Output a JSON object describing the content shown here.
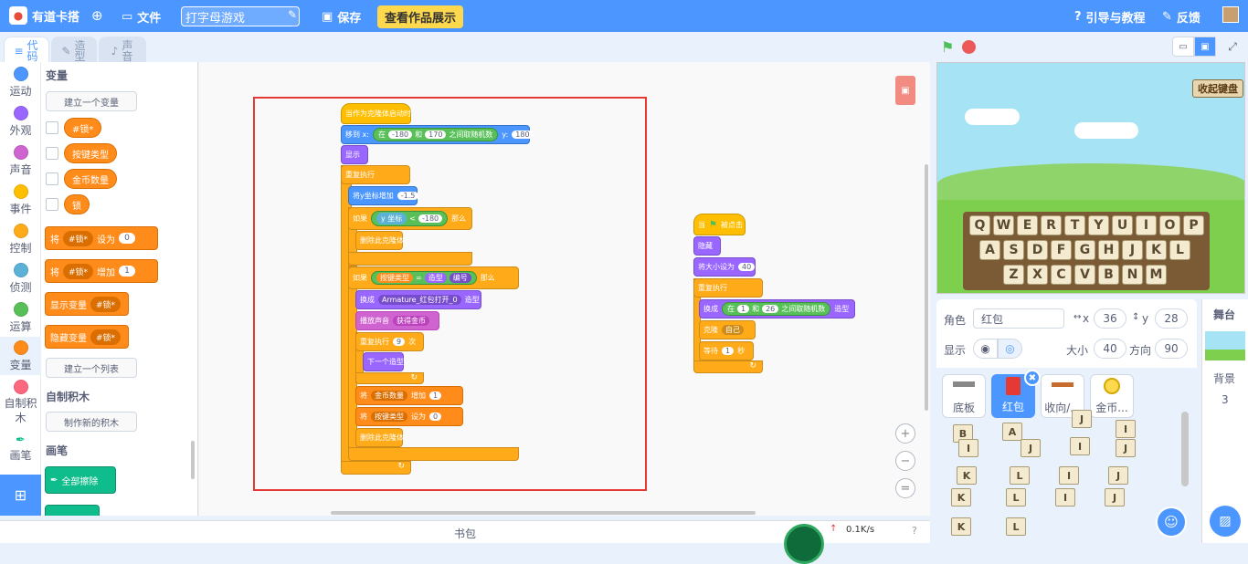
{
  "topbar": {
    "brand": "有道卡搭",
    "file_menu": "文件",
    "project_name": "打字母游戏",
    "save": "保存",
    "showcase": "查看作品展示",
    "guide": "引导与教程",
    "feedback": "反馈"
  },
  "tabs": [
    {
      "label": "代码",
      "active": true
    },
    {
      "label": "造型",
      "active": false
    },
    {
      "label": "声音",
      "active": false
    }
  ],
  "categories": [
    {
      "label": "运动",
      "color": "#4c97ff"
    },
    {
      "label": "外观",
      "color": "#9966ff"
    },
    {
      "label": "声音",
      "color": "#cf63cf"
    },
    {
      "label": "事件",
      "color": "#ffbf00"
    },
    {
      "label": "控制",
      "color": "#ffab19"
    },
    {
      "label": "侦测",
      "color": "#5cb1d6"
    },
    {
      "label": "运算",
      "color": "#59c059"
    },
    {
      "label": "变量",
      "color": "#ff8c1a",
      "selected": true
    },
    {
      "label": "自制积木",
      "color": "#ff6680"
    },
    {
      "label": "画笔",
      "color": "#0fbd8c"
    }
  ],
  "palette": {
    "var_heading": "变量",
    "make_var": "建立一个变量",
    "variables": [
      "#锁*",
      "按键类型",
      "金币数量",
      "锁"
    ],
    "set_block": {
      "prefix": "将",
      "var": "#锁*",
      "mid": "设为",
      "value": "0"
    },
    "change_block": {
      "prefix": "将",
      "var": "#锁*",
      "mid": "增加",
      "value": "1"
    },
    "show_var": {
      "label": "显示变量",
      "var": "#锁*"
    },
    "hide_var": {
      "label": "隐藏变量",
      "var": "#锁*"
    },
    "make_list": "建立一个列表",
    "myblocks_heading": "自制积木",
    "make_block": "制作新的积木",
    "pen_heading": "画笔",
    "erase_all": "全部擦除"
  },
  "script1": {
    "hat": "当作为克隆体启动时",
    "goto_label": "移到 x:",
    "goto_in": "在",
    "goto_a": "-180",
    "goto_and": "和",
    "goto_b": "170",
    "goto_rand": "之间取随机数",
    "goto_y": "y:",
    "goto_yval": "180",
    "show": "显示",
    "forever": "重复执行",
    "change_y": "将y坐标增加",
    "change_y_val": "-1.5",
    "if1": "如果",
    "if1_sensor": "y 坐标",
    "if1_op": "<",
    "if1_val": "-180",
    "if1_then": "那么",
    "delete1": "删除此克隆体",
    "if2": "如果",
    "if2_var": "按键类型",
    "if2_op": "=",
    "if2_look": "造型",
    "if2_look_opt": "编号",
    "if2_then": "那么",
    "switch_costume": "换成",
    "switch_costume_val": "Armature_红包打开_0",
    "switch_costume_suffix": "造型",
    "play_sound": "播放声音",
    "play_sound_val": "获得金币",
    "repeat": "重复执行",
    "repeat_val": "9",
    "repeat_suffix": "次",
    "next_costume": "下一个造型",
    "set1_prefix": "将",
    "set1_var": "金币数量",
    "set1_mid": "增加",
    "set1_val": "1",
    "set2_prefix": "将",
    "set2_var": "按键类型",
    "set2_mid": "设为",
    "set2_val": "0",
    "delete2": "删除此克隆体"
  },
  "script2": {
    "hat_prefix": "当",
    "hat_suffix": "被点击",
    "hide": "隐藏",
    "size": "将大小设为",
    "size_val": "40",
    "forever": "重复执行",
    "switch": "换成",
    "switch_in": "在",
    "switch_a": "1",
    "switch_and": "和",
    "switch_b": "26",
    "switch_rand": "之间取随机数",
    "switch_suffix": "造型",
    "clone": "克隆",
    "clone_val": "自己",
    "wait": "等待",
    "wait_val": "1",
    "wait_suffix": "秒"
  },
  "backpack": "书包",
  "network": "0.1K/s",
  "stage": {
    "keyboard_btn": "收起键盘",
    "rows": [
      [
        "Q",
        "W",
        "E",
        "R",
        "T",
        "Y",
        "U",
        "I",
        "O",
        "P"
      ],
      [
        "A",
        "S",
        "D",
        "F",
        "G",
        "H",
        "J",
        "K",
        "L"
      ],
      [
        "Z",
        "X",
        "C",
        "V",
        "B",
        "N",
        "M"
      ]
    ]
  },
  "sprite": {
    "label": "角色",
    "name": "红包",
    "x_label": "x",
    "x": "36",
    "y_label": "y",
    "y": "28",
    "show_label": "显示",
    "size_label": "大小",
    "size": "40",
    "dir_label": "方向",
    "dir": "90"
  },
  "sprites": [
    {
      "name": "底板",
      "selected": false
    },
    {
      "name": "红包",
      "selected": true
    },
    {
      "name": "收向/...",
      "selected": false
    },
    {
      "name": "金币...",
      "selected": false
    }
  ],
  "tiles": [
    "B",
    "A",
    "J",
    "I",
    "I",
    "J",
    "I",
    "J",
    "K",
    "L",
    "I",
    "J",
    "K",
    "L",
    "I",
    "J",
    "K",
    "L"
  ],
  "stage_pane": {
    "title": "舞台",
    "backdrop_label": "背景",
    "backdrop_count": "3"
  }
}
